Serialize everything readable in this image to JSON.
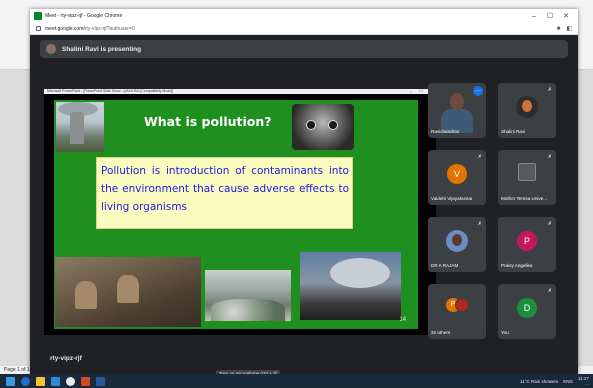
{
  "window": {
    "title": "Meet - rty-vipz-rjf - Google Chrome",
    "url_host": "meet.google.com/",
    "url_path": "rty-vipz-rjf?authuser=0",
    "controls": [
      "–",
      "☐",
      "✕"
    ]
  },
  "meet": {
    "presenter_banner": "Shalini Ravi is presenting",
    "meeting_code": "rty-vipz-rjf",
    "mic_tooltip": "Turn on microphone (ctrl + d)",
    "participant_count": "40"
  },
  "ppt": {
    "bar_title": "Microsoft PowerPoint - [PowerPoint Slide Show - [JAYA RAI [Compatibility Mode]]",
    "bar_controls": [
      "–",
      "☐",
      "✕"
    ]
  },
  "slide": {
    "title": "What is pollution?",
    "text": "Pollution is introduction of contaminants into the environment that cause adverse effects to living organisms",
    "number": "14"
  },
  "participants": [
    {
      "name": "Ravichandran",
      "type": "camera"
    },
    {
      "name": "Shalini Ravi",
      "type": "photo"
    },
    {
      "name": "Vaidehi Vijayakumar",
      "initial": "V",
      "color": "#e37400"
    },
    {
      "name": "Mother Teresa Unive...",
      "type": "thumb"
    },
    {
      "name": "DR A RAJAM",
      "type": "photo2"
    },
    {
      "name": "Praisy Angelika",
      "initial": "P",
      "color": "#c2185b"
    },
    {
      "name": "32 others",
      "initial": "P",
      "color": "#e37400"
    },
    {
      "name": "You",
      "initial": "D",
      "color": "#1e8e3e"
    }
  ],
  "controls": {
    "mic_icon": "mic-off-icon",
    "cam_icon": "videocam-off-icon",
    "captions": "cc",
    "present": "▣",
    "more": "⋮",
    "end": "✆"
  },
  "taskbar": {
    "weather": "11°C  Rain showers",
    "lang": "ENG",
    "time": "11:27",
    "date": "..."
  },
  "word": {
    "status": "Page 1 of 1"
  },
  "colors": {
    "meet_bg": "#202124",
    "tile_bg": "#3c4043",
    "slide_green": "#1f8f1f",
    "slide_text": "#1a1ae0",
    "danger": "#ea4335"
  }
}
